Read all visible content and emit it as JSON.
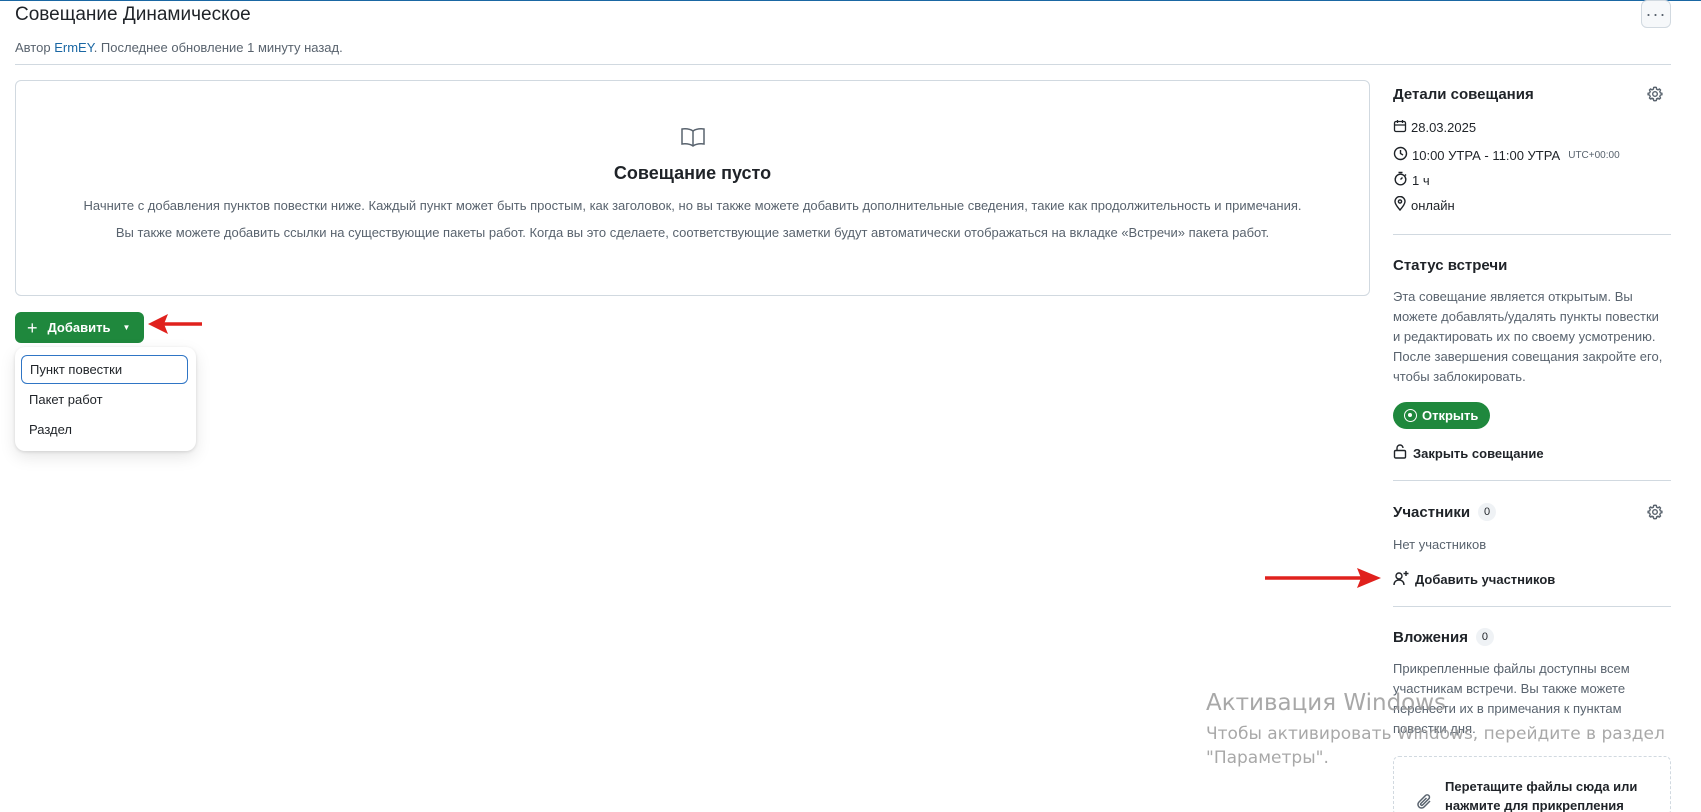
{
  "header": {
    "title": "Совещание Динамическое",
    "byline_prefix": "Автор",
    "author": "ErmEY",
    "byline_suffix": ". Последнее обновление 1 минуту назад.",
    "more_label": "···"
  },
  "blank_state": {
    "icon": "book-open-icon",
    "title": "Совещание пусто",
    "text1": "Начните с добавления пунктов повестки ниже. Каждый пункт может быть простым, как заголовок, но вы также можете добавить дополнительные сведения, такие как продолжительность и примечания.",
    "text2": "Вы также можете добавить ссылки на существующие пакеты работ. Когда вы это сделаете, соответствующие заметки будут автоматически отображаться на вкладке «Встречи» пакета работ."
  },
  "add_button": {
    "plus": "+",
    "label": "Добавить",
    "caret": "▼"
  },
  "add_menu": {
    "items": [
      {
        "label": "Пункт повестки",
        "active": true
      },
      {
        "label": "Пакет работ",
        "active": false
      },
      {
        "label": "Раздел",
        "active": false
      }
    ]
  },
  "sidebar": {
    "details": {
      "heading": "Детали совещания",
      "date": "28.03.2025",
      "time": "10:00 УТРА - 11:00 УТРА",
      "timezone": "UTC+00:00",
      "duration": "1 ч",
      "location": "онлайн"
    },
    "status": {
      "heading": "Статус встречи",
      "description": "Эта совещание является открытым. Вы можете добавлять/удалять пункты повестки и редактировать их по своему усмотрению. После завершения совещания закройте его, чтобы заблокировать.",
      "open_label": "Открыть",
      "close_label": "Закрыть совещание"
    },
    "participants": {
      "heading": "Участники",
      "count": "0",
      "empty_text": "Нет участников",
      "add_label": "Добавить участников"
    },
    "attachments": {
      "heading": "Вложения",
      "count": "0",
      "description": "Прикрепленные файлы доступны всем участникам встречи. Вы также можете перенести их в примечания к пунктам повестки дня.",
      "dropzone_text": "Перетащите файлы сюда или нажмите для прикрепления"
    }
  },
  "watermark": {
    "title": "Активация Windows",
    "line1": "Чтобы активировать Windows, перейдите в раздел",
    "line2": "\"Параметры\"."
  },
  "colors": {
    "primary_green": "#1f883d",
    "link_blue": "#1a67a3",
    "annotation_red": "#e0211d"
  }
}
